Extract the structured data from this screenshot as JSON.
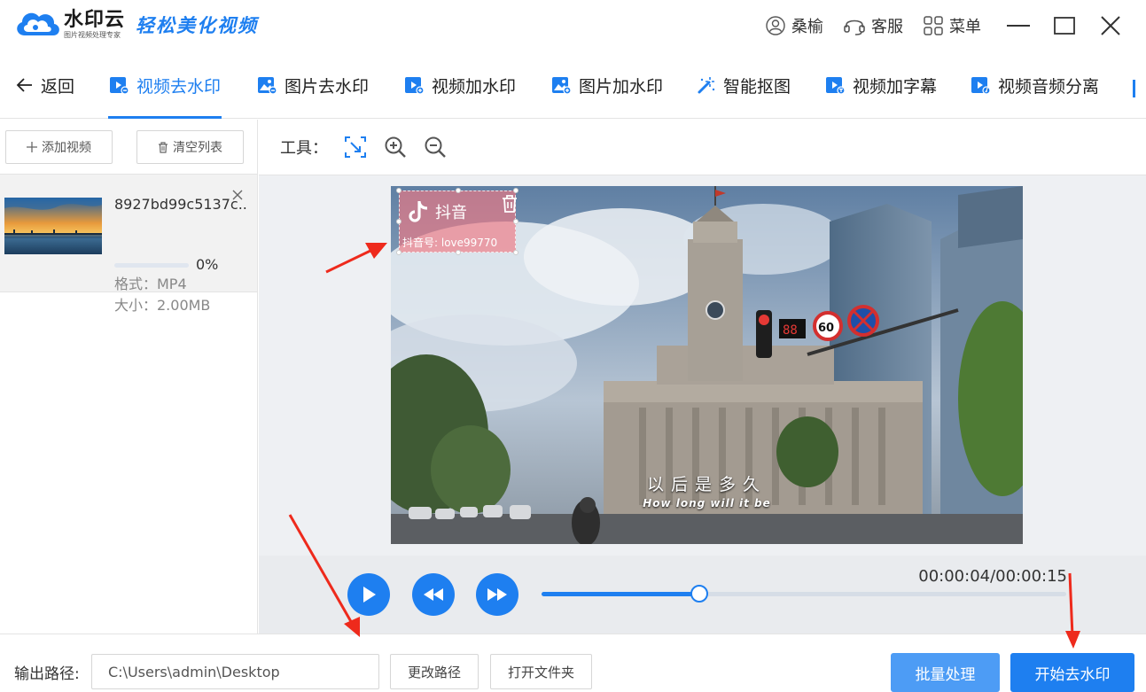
{
  "app": {
    "name": "水印云",
    "subtitle": "图片视频处理专家",
    "slogan": "轻松美化视频"
  },
  "topbar": {
    "user": "桑榆",
    "service": "客服",
    "menu": "菜单"
  },
  "nav": {
    "back": "返回",
    "tabs": [
      {
        "label": "视频去水印",
        "icon": "video-icon"
      },
      {
        "label": "图片去水印",
        "icon": "image-icon"
      },
      {
        "label": "视频加水印",
        "icon": "video-add-icon"
      },
      {
        "label": "图片加水印",
        "icon": "image-add-icon"
      },
      {
        "label": "智能抠图",
        "icon": "magic-wand-icon"
      },
      {
        "label": "视频加字幕",
        "icon": "video-subtitle-icon"
      },
      {
        "label": "视频音频分离",
        "icon": "video-audio-icon"
      }
    ],
    "active_index": 0
  },
  "left": {
    "add_video": "添加视频",
    "clear_list": "清空列表",
    "files": [
      {
        "name": "8927bd99c5137c...",
        "format": "格式：MP4",
        "size": "大小：2.00MB",
        "progress_text": "0%",
        "progress": 0
      }
    ]
  },
  "tools": {
    "label": "工具："
  },
  "video": {
    "watermark_title": "抖音",
    "watermark_id": "抖音号: love99770",
    "subtitle_cn": "以后是多久",
    "subtitle_en": "How long will it be"
  },
  "player": {
    "timecode": "00:00:04/00:00:15",
    "progress": 0.3
  },
  "bottom": {
    "output_label": "输出路径:",
    "output_path": "C:\\Users\\admin\\Desktop",
    "change_path": "更改路径",
    "open_folder": "打开文件夹",
    "batch": "批量处理",
    "start": "开始去水印"
  },
  "colors": {
    "accent": "#1e7ff0",
    "batch_button": "#4d9cf5",
    "annotation_arrow": "#ee2a1c"
  }
}
